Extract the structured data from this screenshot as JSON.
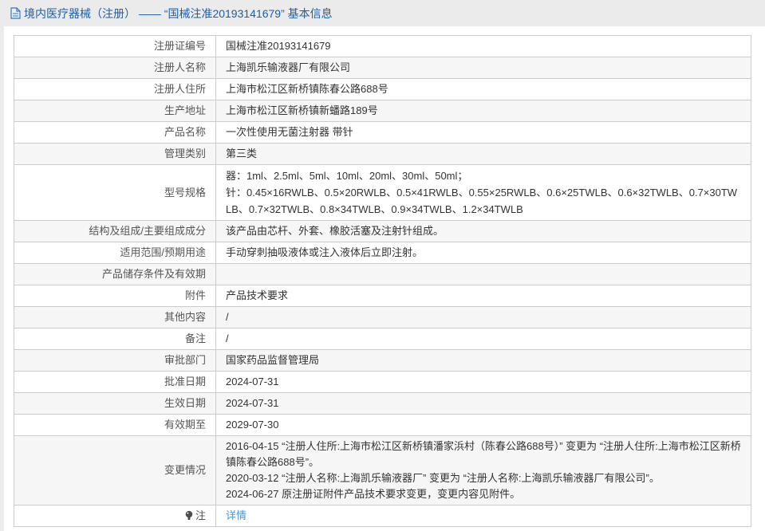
{
  "header": {
    "icon": "document-icon",
    "title": "境内医疗器械（注册） —— “国械注准20193141679” 基本信息"
  },
  "colors": {
    "header_bg": "#ebebeb",
    "header_text": "#1c5fa8",
    "row_stripe": "#f6f6f6",
    "cell_border": "#cccccc",
    "link": "#4897d8",
    "label_text": "#555555",
    "value_text": "#333333"
  },
  "table": {
    "rows": [
      {
        "key": "reg-no",
        "label": "注册证编号",
        "value": "国械注准20193141679"
      },
      {
        "key": "registrant-name",
        "label": "注册人名称",
        "value": "上海凯乐输液器厂有限公司"
      },
      {
        "key": "registrant-address",
        "label": "注册人住所",
        "value": "上海市松江区新桥镇陈春公路688号"
      },
      {
        "key": "production-address",
        "label": "生产地址",
        "value": "上海市松江区新桥镇新蟠路189号"
      },
      {
        "key": "product-name",
        "label": "产品名称",
        "value": "一次性使用无菌注射器 带针"
      },
      {
        "key": "management-class",
        "label": "管理类别",
        "value": "第三类"
      },
      {
        "key": "model-spec",
        "label": "型号规格",
        "value_lines": [
          "器：1ml、2.5ml、5ml、10ml、20ml、30ml、50ml；",
          "针：0.45×16RWLB、0.5×20RWLB、0.5×41RWLB、0.55×25RWLB、0.6×25TWLB、0.6×32TWLB、0.7×30TWLB、0.7×32TWLB、0.8×34TWLB、0.9×34TWLB、1.2×34TWLB"
        ]
      },
      {
        "key": "structure-composition",
        "label": "结构及组成/主要组成成分",
        "value": "该产品由芯杆、外套、橡胶活塞及注射针组成。"
      },
      {
        "key": "intended-use",
        "label": "适用范围/预期用途",
        "value": "手动穿刺抽吸液体或注入液体后立即注射。"
      },
      {
        "key": "storage-validity",
        "label": "产品储存条件及有效期",
        "value": ""
      },
      {
        "key": "attachment",
        "label": "附件",
        "value": "产品技术要求"
      },
      {
        "key": "other-content",
        "label": "其他内容",
        "value": "/"
      },
      {
        "key": "remarks",
        "label": "备注",
        "value": "/"
      },
      {
        "key": "approval-dept",
        "label": "审批部门",
        "value": "国家药品监督管理局"
      },
      {
        "key": "approval-date",
        "label": "批准日期",
        "value": "2024-07-31"
      },
      {
        "key": "effective-date",
        "label": "生效日期",
        "value": "2024-07-31"
      },
      {
        "key": "expiry-date",
        "label": "有效期至",
        "value": "2029-07-30"
      },
      {
        "key": "change-history",
        "label": "变更情况",
        "value_lines": [
          "2016-04-15 “注册人住所:上海市松江区新桥镇潘家浜村（陈春公路688号）” 变更为 “注册人住所:上海市松江区新桥镇陈春公路688号”。",
          "2020-03-12 “注册人名称:上海凯乐输液器厂” 变更为 “注册人名称:上海凯乐输液器厂有限公司”。",
          "2024-06-27 原注册证附件产品技术要求变更，变更内容见附件。"
        ],
        "lines_class": "change-lines"
      },
      {
        "key": "note",
        "label": "注",
        "icon": "bulb-icon",
        "link": "详情"
      }
    ]
  }
}
